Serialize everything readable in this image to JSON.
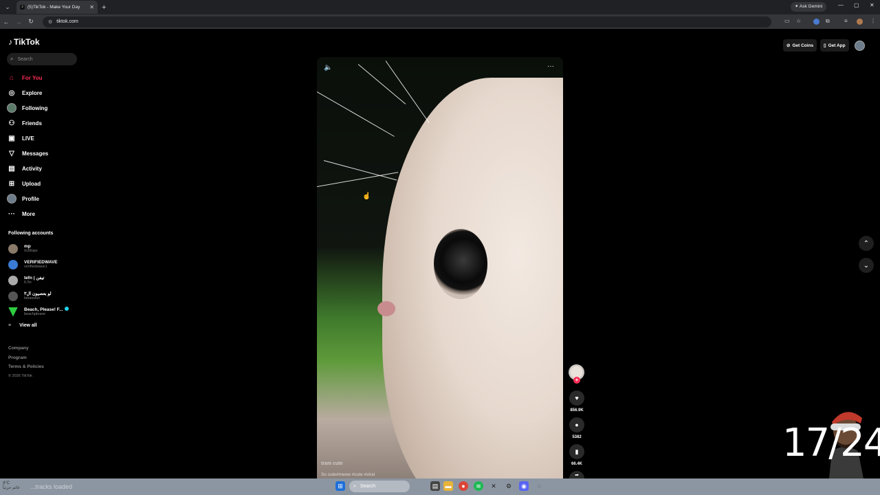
{
  "browser": {
    "tab_title": "(5)TikTok - Make Your Day",
    "tab_close": "✕",
    "new_tab": "+",
    "url": "tiktok.com",
    "gemini_label": "Ask Gemini",
    "window_controls": [
      "—",
      "▢",
      "✕"
    ]
  },
  "sidebar": {
    "logo": "TikTok",
    "search_placeholder": "Search",
    "nav": [
      {
        "label": "For You",
        "icon": "home-icon"
      },
      {
        "label": "Explore",
        "icon": "compass-icon"
      },
      {
        "label": "Following",
        "icon": "following-avatar-icon"
      },
      {
        "label": "Friends",
        "icon": "friends-icon"
      },
      {
        "label": "LIVE",
        "icon": "live-icon"
      },
      {
        "label": "Messages",
        "icon": "messages-icon"
      },
      {
        "label": "Activity",
        "icon": "activity-icon"
      },
      {
        "label": "Upload",
        "icon": "upload-icon"
      },
      {
        "label": "Profile",
        "icon": "profile-icon"
      },
      {
        "label": "More",
        "icon": "more-icon"
      }
    ],
    "following_title": "Following accounts",
    "accounts": [
      {
        "name": "mp",
        "handle": "m39ops",
        "color": "#8a7a68"
      },
      {
        "name": "VERIFIEDWAVE",
        "handle": "verifiedwave1",
        "color": "#3a7bd5"
      },
      {
        "name": "tefn | تيفن",
        "handle": "6.5n",
        "color": "#aaaaaa"
      },
      {
        "name": "لو بعصيون ال٣",
        "handle": "lebassion",
        "color": "#555555"
      },
      {
        "name": "Beach, Please! F...",
        "handle": "beachplease",
        "color": "#2ecc40",
        "verified": true
      }
    ],
    "view_all": "View all",
    "footer": [
      "Company",
      "Program",
      "Terms & Policies",
      "© 2026 TikTok"
    ]
  },
  "header": {
    "get_coins": "Get Coins",
    "get_app": "Get App"
  },
  "video": {
    "caption": "tram cute",
    "tags": "So cute#meow #cute #viral",
    "likes": "856.9K",
    "comments": "5382",
    "saves": "66.4K"
  },
  "overlay": {
    "counter": "17/24"
  },
  "taskbar": {
    "weather_temp": "4°C",
    "weather_desc": "غائم جزئياً",
    "status": "...tracks loaded",
    "search": "Search"
  },
  "colors": {
    "accent": "#fe2c55",
    "verified": "#20d5ec"
  }
}
